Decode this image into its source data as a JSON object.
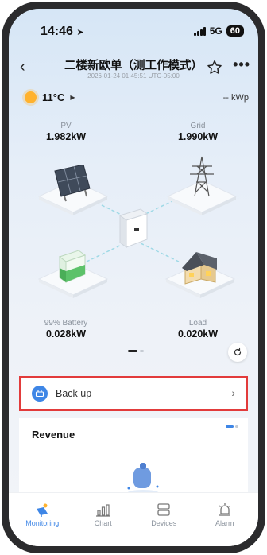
{
  "status_bar": {
    "time": "14:46",
    "network": "5G",
    "battery": "60"
  },
  "header": {
    "title": "二楼新欧单（测工作模式）",
    "subtitle": "2026-01-24 01:45:51 UTC-05:00"
  },
  "weather": {
    "temperature": "11°C",
    "capacity": "-- kWp"
  },
  "energy_flow": {
    "pv": {
      "label": "PV",
      "value": "1.982kW"
    },
    "grid": {
      "label": "Grid",
      "value": "1.990kW"
    },
    "battery": {
      "label": "99% Battery",
      "value": "0.028kW",
      "soc_percent": 99
    },
    "load": {
      "label": "Load",
      "value": "0.020kW"
    }
  },
  "backup": {
    "label": "Back up"
  },
  "revenue": {
    "title": "Revenue"
  },
  "bottom_nav": {
    "items": [
      {
        "label": "Monitoring",
        "icon": "monitoring-icon",
        "active": true
      },
      {
        "label": "Chart",
        "icon": "chart-icon",
        "active": false
      },
      {
        "label": "Devices",
        "icon": "devices-icon",
        "active": false
      },
      {
        "label": "Alarm",
        "icon": "alarm-icon",
        "active": false
      }
    ]
  },
  "colors": {
    "accent": "#3e86e6",
    "highlight_border": "#e23b3b",
    "sun": "#ffb22e",
    "battery_fill": "#5cc26a"
  }
}
